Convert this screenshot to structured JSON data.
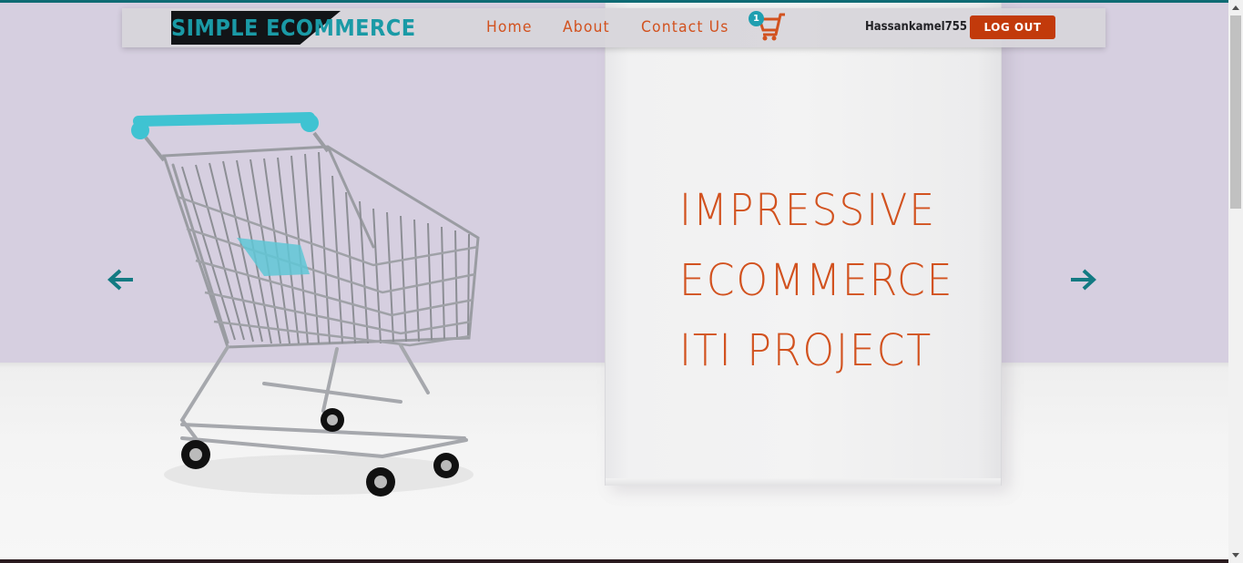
{
  "brand": {
    "name": "SIMPLE ECOMMERCE"
  },
  "nav": {
    "items": [
      {
        "label": "Home"
      },
      {
        "label": "About"
      },
      {
        "label": "Contact Us"
      }
    ],
    "cart_count": "1",
    "cart_icon": "shopping-cart-icon"
  },
  "user": {
    "username": "Hassankamel755",
    "logout_label": "LOG OUT"
  },
  "hero": {
    "lines": [
      "IMPRESSIVE",
      "ECOMMERCE",
      "ITI PROJECT"
    ],
    "prev_icon": "arrow-left-icon",
    "next_icon": "arrow-right-icon"
  },
  "colors": {
    "accent": "#d2521f",
    "teal": "#1a9aa6",
    "logout_bg": "#c23a0b",
    "hero_bg": "#d6cfe0"
  }
}
